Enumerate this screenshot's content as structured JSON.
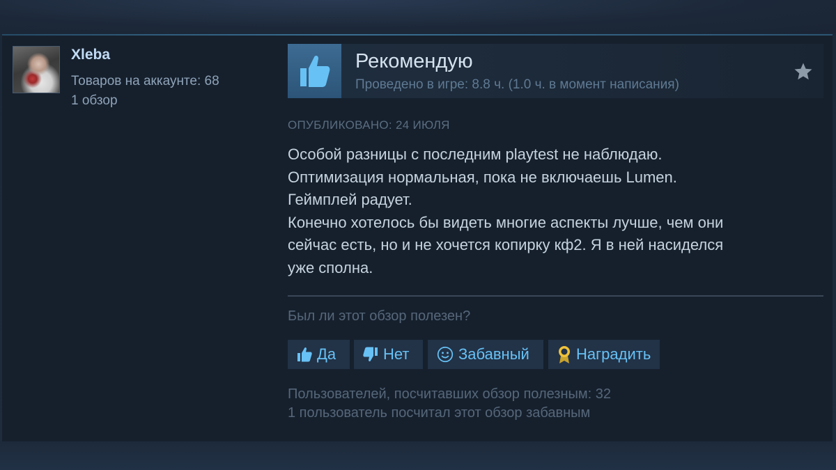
{
  "author": {
    "name": "Xleba",
    "products_label": "Товаров на аккаунте: 68",
    "reviews_label": "1 обзор"
  },
  "review": {
    "verdict": "Рекомендую",
    "hours": "Проведено в игре: 8.8 ч. (1.0 ч. в момент написания)",
    "posted": "ОПУБЛИКОВАНО: 24 ИЮЛЯ",
    "body": [
      "Особой разницы с последним playtest не наблюдаю.",
      "Оптимизация нормальная, пока не включаешь Lumen.",
      "Геймплей радует.",
      "Конечно хотелось бы видеть многие аспекты лучше, чем они",
      "сейчас есть, но и не хочется копирку кф2. Я в ней насиделся",
      "уже сполна."
    ]
  },
  "feedback": {
    "question": "Был ли этот обзор полезен?",
    "buttons": {
      "yes": "Да",
      "no": "Нет",
      "funny": "Забавный",
      "award": "Наградить"
    },
    "helpful_count": "Пользователей, посчитавших обзор полезным: 32",
    "funny_count": "1 пользователь посчитал этот обзор забавным"
  },
  "icons": {
    "verdict": "thumbs-up-icon",
    "award_star": "star-icon",
    "yes": "thumbs-up-icon",
    "no": "thumbs-down-icon",
    "funny": "smiley-icon",
    "award": "award-ribbon-icon"
  },
  "colors": {
    "card_bg": "#16202d",
    "accent_blue": "#67c1f5",
    "name": "#c1dbf4",
    "body_text": "#c6d4df",
    "muted": "#56677a"
  }
}
